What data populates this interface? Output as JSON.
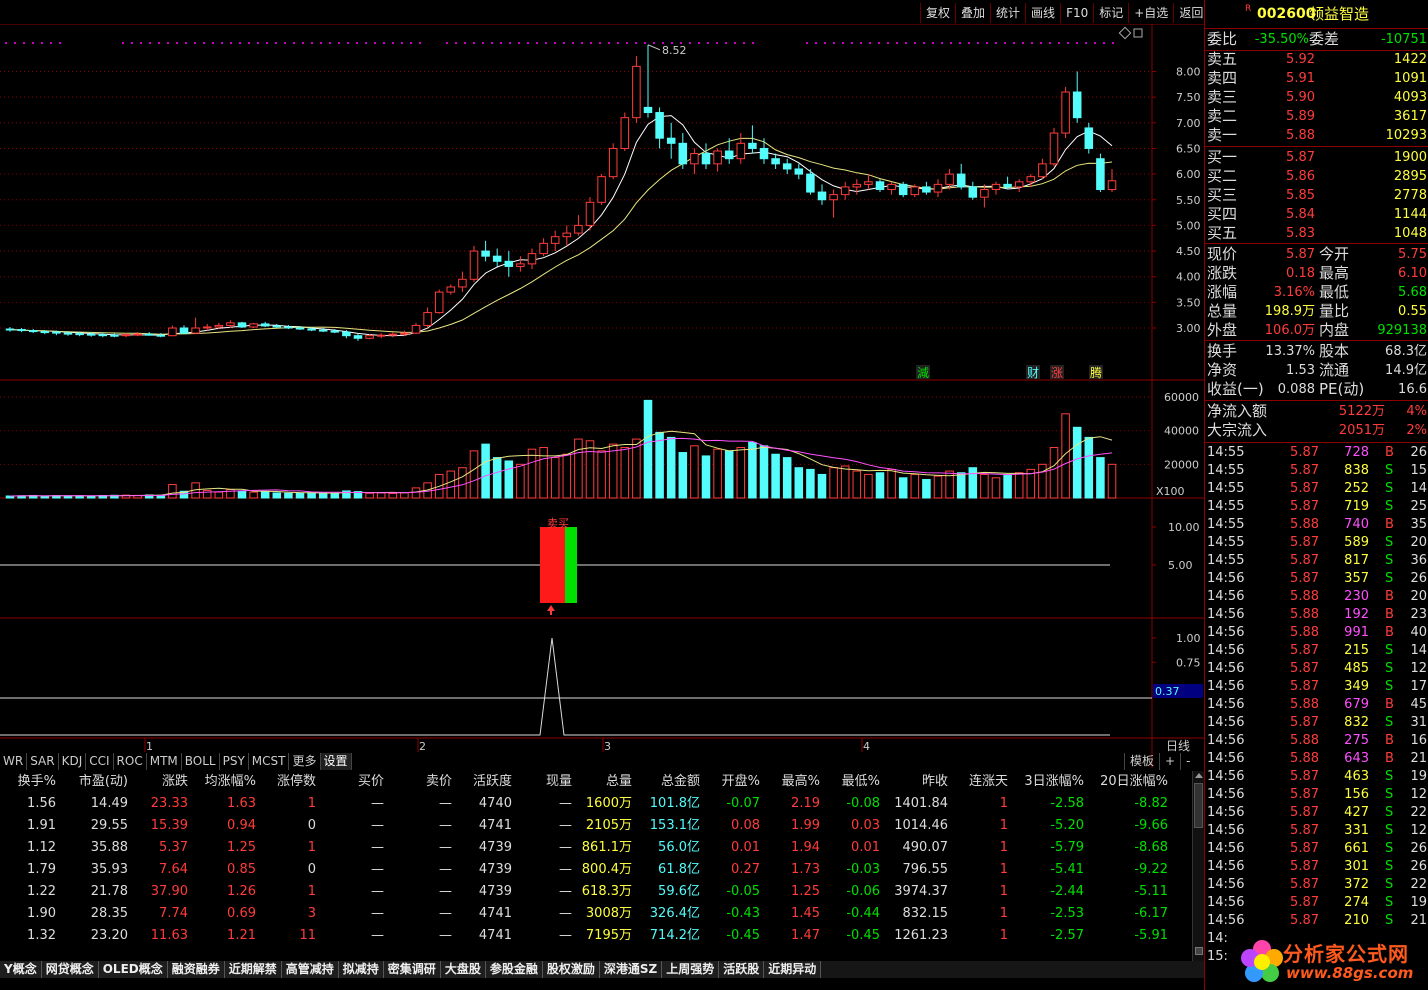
{
  "toolbar": [
    "复权",
    "叠加",
    "统计",
    "画线",
    "F10",
    "标记",
    "+自选",
    "返回"
  ],
  "chart": {
    "price_axis": [
      "8.00",
      "7.50",
      "7.00",
      "6.50",
      "6.00",
      "5.50",
      "5.00",
      "4.50",
      "4.00",
      "3.50",
      "3.00"
    ],
    "high_label": "8.52",
    "volume_axis": [
      "60000",
      "40000",
      "20000"
    ],
    "volume_unit": "X100",
    "ind3_axis": [
      "10.00",
      "5.00"
    ],
    "ind4_axis": [
      "1.00",
      "0.75"
    ],
    "ind4_value": "0.37",
    "month_labels": [
      "1",
      "2",
      "3",
      "4"
    ],
    "period": "日线",
    "event_labels": [
      {
        "text": "減",
        "color": "#00e000"
      },
      {
        "text": "财",
        "color": "#54fcfc"
      },
      {
        "text": "涨",
        "color": "#ff3c3c"
      },
      {
        "text": "腾",
        "color": "#ffff40"
      }
    ],
    "ind3_label": "卖买",
    "candles": [
      [
        2.98,
        3.02,
        2.93,
        2.97
      ],
      [
        2.97,
        3.0,
        2.92,
        2.95
      ],
      [
        2.95,
        2.98,
        2.9,
        2.93
      ],
      [
        2.93,
        2.96,
        2.88,
        2.92
      ],
      [
        2.92,
        2.95,
        2.86,
        2.9
      ],
      [
        2.9,
        2.94,
        2.85,
        2.89
      ],
      [
        2.89,
        2.93,
        2.84,
        2.88
      ],
      [
        2.88,
        2.92,
        2.83,
        2.87
      ],
      [
        2.87,
        2.91,
        2.82,
        2.86
      ],
      [
        2.86,
        2.9,
        2.82,
        2.85
      ],
      [
        2.85,
        2.9,
        2.82,
        2.87
      ],
      [
        2.87,
        2.92,
        2.84,
        2.88
      ],
      [
        2.88,
        2.92,
        2.85,
        2.86
      ],
      [
        2.86,
        2.9,
        2.82,
        2.85
      ],
      [
        2.85,
        3.05,
        2.84,
        3.0
      ],
      [
        3.0,
        3.05,
        2.88,
        2.9
      ],
      [
        2.9,
        3.2,
        2.88,
        3.0
      ],
      [
        3.0,
        3.08,
        2.95,
        3.02
      ],
      [
        3.02,
        3.1,
        2.98,
        3.05
      ],
      [
        3.05,
        3.15,
        3.0,
        3.1
      ],
      [
        3.1,
        3.12,
        3.0,
        3.02
      ],
      [
        3.02,
        3.1,
        3.0,
        3.08
      ],
      [
        3.08,
        3.12,
        3.02,
        3.04
      ],
      [
        3.04,
        3.08,
        3.0,
        3.02
      ],
      [
        3.02,
        3.06,
        2.98,
        3.0
      ],
      [
        3.0,
        3.04,
        2.96,
        2.98
      ],
      [
        2.98,
        3.02,
        2.94,
        2.96
      ],
      [
        2.96,
        3.0,
        2.92,
        2.94
      ],
      [
        2.94,
        2.98,
        2.9,
        2.92
      ],
      [
        2.92,
        2.96,
        2.8,
        2.85
      ],
      [
        2.85,
        2.9,
        2.75,
        2.8
      ],
      [
        2.8,
        2.88,
        2.78,
        2.85
      ],
      [
        2.85,
        2.9,
        2.8,
        2.86
      ],
      [
        2.86,
        2.92,
        2.82,
        2.88
      ],
      [
        2.88,
        2.95,
        2.84,
        2.9
      ],
      [
        2.9,
        3.1,
        2.88,
        3.05
      ],
      [
        3.05,
        3.4,
        3.02,
        3.3
      ],
      [
        3.3,
        3.75,
        3.28,
        3.7
      ],
      [
        3.7,
        3.85,
        3.65,
        3.8
      ],
      [
        3.8,
        4.1,
        3.7,
        3.95
      ],
      [
        3.95,
        4.6,
        3.9,
        4.5
      ],
      [
        4.5,
        4.7,
        4.3,
        4.4
      ],
      [
        4.4,
        4.55,
        4.2,
        4.3
      ],
      [
        4.3,
        4.5,
        4.0,
        4.2
      ],
      [
        4.2,
        4.4,
        4.1,
        4.25
      ],
      [
        4.25,
        4.55,
        4.15,
        4.45
      ],
      [
        4.45,
        4.75,
        4.4,
        4.65
      ],
      [
        4.65,
        4.9,
        4.5,
        4.78
      ],
      [
        4.78,
        5.0,
        4.6,
        4.85
      ],
      [
        4.85,
        5.2,
        4.8,
        5.0
      ],
      [
        5.0,
        5.55,
        4.9,
        5.45
      ],
      [
        5.45,
        6.0,
        5.4,
        5.95
      ],
      [
        5.95,
        6.6,
        5.9,
        6.5
      ],
      [
        6.5,
        7.2,
        6.45,
        7.1
      ],
      [
        7.1,
        8.3,
        7.0,
        8.1
      ],
      [
        7.3,
        8.52,
        7.1,
        7.2
      ],
      [
        7.2,
        7.3,
        6.5,
        6.7
      ],
      [
        6.7,
        7.0,
        6.3,
        6.6
      ],
      [
        6.6,
        6.8,
        6.1,
        6.2
      ],
      [
        6.2,
        6.5,
        6.0,
        6.4
      ],
      [
        6.4,
        6.6,
        6.1,
        6.2
      ],
      [
        6.2,
        6.5,
        6.05,
        6.45
      ],
      [
        6.45,
        6.7,
        6.2,
        6.3
      ],
      [
        6.3,
        6.8,
        6.2,
        6.6
      ],
      [
        6.6,
        6.95,
        6.4,
        6.5
      ],
      [
        6.5,
        6.7,
        6.2,
        6.3
      ],
      [
        6.3,
        6.4,
        6.1,
        6.2
      ],
      [
        6.2,
        6.3,
        6.0,
        6.1
      ],
      [
        6.1,
        6.2,
        5.9,
        6.0
      ],
      [
        6.0,
        6.1,
        5.6,
        5.65
      ],
      [
        5.65,
        5.8,
        5.4,
        5.5
      ],
      [
        5.5,
        5.7,
        5.15,
        5.6
      ],
      [
        5.6,
        5.85,
        5.5,
        5.75
      ],
      [
        5.75,
        5.9,
        5.6,
        5.8
      ],
      [
        5.8,
        6.0,
        5.7,
        5.85
      ],
      [
        5.85,
        5.9,
        5.65,
        5.7
      ],
      [
        5.7,
        5.85,
        5.6,
        5.8
      ],
      [
        5.8,
        5.85,
        5.55,
        5.6
      ],
      [
        5.6,
        5.8,
        5.55,
        5.75
      ],
      [
        5.75,
        5.85,
        5.6,
        5.65
      ],
      [
        5.65,
        5.9,
        5.55,
        5.8
      ],
      [
        5.8,
        6.1,
        5.7,
        6.0
      ],
      [
        6.0,
        6.2,
        5.7,
        5.75
      ],
      [
        5.75,
        5.85,
        5.5,
        5.55
      ],
      [
        5.55,
        5.8,
        5.35,
        5.7
      ],
      [
        5.7,
        5.85,
        5.6,
        5.8
      ],
      [
        5.8,
        5.95,
        5.7,
        5.75
      ],
      [
        5.75,
        5.9,
        5.65,
        5.85
      ],
      [
        5.85,
        6.0,
        5.75,
        5.95
      ],
      [
        5.95,
        6.3,
        5.9,
        6.2
      ],
      [
        6.2,
        6.9,
        6.15,
        6.8
      ],
      [
        6.8,
        7.7,
        6.7,
        7.6
      ],
      [
        7.6,
        8.0,
        7.0,
        7.1
      ],
      [
        6.9,
        7.0,
        6.4,
        6.5
      ],
      [
        6.3,
        6.4,
        5.65,
        5.7
      ],
      [
        5.7,
        6.1,
        5.65,
        5.87
      ]
    ],
    "volumes": [
      1200,
      1300,
      1500,
      1100,
      1400,
      1250,
      1350,
      1200,
      1500,
      1600,
      1700,
      1550,
      1800,
      1600,
      8000,
      4000,
      9000,
      4500,
      3500,
      5000,
      4000,
      3500,
      3800,
      3000,
      2800,
      3000,
      3200,
      2900,
      2600,
      4200,
      3800,
      2800,
      3000,
      2700,
      3200,
      6000,
      9000,
      14000,
      16000,
      18000,
      28000,
      32000,
      24000,
      22000,
      20000,
      29000,
      30000,
      24000,
      26000,
      35000,
      34000,
      28000,
      32000,
      30000,
      35000,
      58000,
      39000,
      36000,
      27000,
      31000,
      25000,
      29000,
      28000,
      30000,
      33000,
      31000,
      26000,
      24000,
      18000,
      17000,
      14000,
      18000,
      19000,
      16000,
      14000,
      15000,
      17000,
      12000,
      14000,
      11000,
      13000,
      16000,
      15000,
      18000,
      14000,
      12000,
      14000,
      15000,
      17000,
      20000,
      30000,
      50000,
      42000,
      36000,
      24000,
      20000
    ]
  },
  "indicators": [
    "WR",
    "SAR",
    "KDJ",
    "CCI",
    "ROC",
    "MTM",
    "BOLL",
    "PSY",
    "MCST",
    "更多",
    "设置"
  ],
  "template_tabs": [
    "模板",
    "+",
    "-"
  ],
  "table": {
    "columns": [
      "换手%",
      "市盈(动)",
      "涨跌",
      "均涨幅%",
      "涨停数",
      "买价",
      "卖价",
      "活跃度",
      "现量",
      "总量",
      "总金额",
      "开盘%",
      "最高%",
      "最低%",
      "昨收",
      "连涨天",
      "3日涨幅%",
      "20日涨幅%"
    ],
    "rows": [
      [
        "1.56",
        "14.49",
        "23.33",
        "1.63",
        "1",
        "—",
        "—",
        "4740",
        "—",
        "1600万",
        "101.8亿",
        "-0.07",
        "2.19",
        "-0.08",
        "1401.84",
        "1",
        "-2.58",
        "-8.82"
      ],
      [
        "1.91",
        "29.55",
        "15.39",
        "0.94",
        "0",
        "—",
        "—",
        "4741",
        "—",
        "2105万",
        "153.1亿",
        "0.08",
        "1.99",
        "0.03",
        "1014.46",
        "1",
        "-5.20",
        "-9.66"
      ],
      [
        "1.12",
        "35.88",
        "5.37",
        "1.25",
        "1",
        "—",
        "—",
        "4739",
        "—",
        "861.1万",
        "56.0亿",
        "0.01",
        "1.94",
        "0.01",
        "490.07",
        "1",
        "-5.79",
        "-8.68"
      ],
      [
        "1.79",
        "35.93",
        "7.64",
        "0.85",
        "0",
        "—",
        "—",
        "4739",
        "—",
        "800.4万",
        "61.8亿",
        "0.27",
        "1.73",
        "-0.03",
        "796.55",
        "1",
        "-5.41",
        "-9.22"
      ],
      [
        "1.22",
        "21.78",
        "37.90",
        "1.26",
        "1",
        "—",
        "—",
        "4739",
        "—",
        "618.3万",
        "59.6亿",
        "-0.05",
        "1.25",
        "-0.06",
        "3974.37",
        "1",
        "-2.44",
        "-5.11"
      ],
      [
        "1.90",
        "28.35",
        "7.74",
        "0.69",
        "3",
        "—",
        "—",
        "4741",
        "—",
        "3008万",
        "326.4亿",
        "-0.43",
        "1.45",
        "-0.44",
        "832.15",
        "1",
        "-2.53",
        "-6.17"
      ],
      [
        "1.32",
        "23.20",
        "11.63",
        "1.21",
        "11",
        "—",
        "—",
        "4741",
        "—",
        "7195万",
        "714.2亿",
        "-0.45",
        "1.47",
        "-0.45",
        "1261.23",
        "1",
        "-2.57",
        "-5.91"
      ]
    ]
  },
  "sector_tabs": [
    "Y概念",
    "网贷概念",
    "OLED概念",
    "融资融券",
    "近期解禁",
    "高管减持",
    "拟减持",
    "密集调研",
    "大盘股",
    "参股金融",
    "股权激励",
    "深港通SZ",
    "上周强势",
    "活跃股",
    "近期异动"
  ],
  "quote": {
    "r_mark": "R",
    "code": "002600",
    "name": "领益智造",
    "weibi_label": "委比",
    "weibi": "-35.50%",
    "weicha_label": "委差",
    "weicha": "-10751",
    "asks": [
      [
        "卖五",
        "5.92",
        "1422"
      ],
      [
        "卖四",
        "5.91",
        "1091"
      ],
      [
        "卖三",
        "5.90",
        "4093"
      ],
      [
        "卖二",
        "5.89",
        "3617"
      ],
      [
        "卖一",
        "5.88",
        "10293"
      ]
    ],
    "bids": [
      [
        "买一",
        "5.87",
        "1900"
      ],
      [
        "买二",
        "5.86",
        "2895"
      ],
      [
        "买三",
        "5.85",
        "2778"
      ],
      [
        "买四",
        "5.84",
        "1144"
      ],
      [
        "买五",
        "5.83",
        "1048"
      ]
    ],
    "stats": [
      [
        "现价",
        "5.87",
        "今开",
        "5.75"
      ],
      [
        "涨跌",
        "0.18",
        "最高",
        "6.10"
      ],
      [
        "涨幅",
        "3.16%",
        "最低",
        "5.68"
      ],
      [
        "总量",
        "198.9万",
        "量比",
        "0.55"
      ],
      [
        "外盘",
        "106.0万",
        "内盘",
        "929138"
      ]
    ],
    "stats2": [
      [
        "换手",
        "13.37%",
        "股本",
        "68.3亿"
      ],
      [
        "净资",
        "1.53",
        "流通",
        "14.9亿"
      ],
      [
        "收益(一)",
        "0.088",
        "PE(动)",
        "16.6"
      ]
    ],
    "flow": [
      [
        "净流入额",
        "5122万",
        "4%"
      ],
      [
        "大宗流入",
        "2051万",
        "2%"
      ]
    ]
  },
  "ticks": [
    [
      "14:55",
      "5.87",
      "728",
      "B",
      "26"
    ],
    [
      "14:55",
      "5.87",
      "838",
      "S",
      "15"
    ],
    [
      "14:55",
      "5.87",
      "252",
      "S",
      "14"
    ],
    [
      "14:55",
      "5.87",
      "719",
      "S",
      "25"
    ],
    [
      "14:55",
      "5.88",
      "740",
      "B",
      "35"
    ],
    [
      "14:55",
      "5.87",
      "589",
      "S",
      "20"
    ],
    [
      "14:55",
      "5.87",
      "817",
      "S",
      "36"
    ],
    [
      "14:56",
      "5.87",
      "357",
      "S",
      "26"
    ],
    [
      "14:56",
      "5.88",
      "230",
      "B",
      "20"
    ],
    [
      "14:56",
      "5.88",
      "192",
      "B",
      "23"
    ],
    [
      "14:56",
      "5.88",
      "991",
      "B",
      "40"
    ],
    [
      "14:56",
      "5.87",
      "215",
      "S",
      "14"
    ],
    [
      "14:56",
      "5.87",
      "485",
      "S",
      "12"
    ],
    [
      "14:56",
      "5.87",
      "349",
      "S",
      "17"
    ],
    [
      "14:56",
      "5.88",
      "679",
      "B",
      "45"
    ],
    [
      "14:56",
      "5.87",
      "832",
      "S",
      "31"
    ],
    [
      "14:56",
      "5.88",
      "275",
      "B",
      "16"
    ],
    [
      "14:56",
      "5.88",
      "643",
      "B",
      "21"
    ],
    [
      "14:56",
      "5.87",
      "463",
      "S",
      "19"
    ],
    [
      "14:56",
      "5.87",
      "156",
      "S",
      "12"
    ],
    [
      "14:56",
      "5.87",
      "427",
      "S",
      "22"
    ],
    [
      "14:56",
      "5.87",
      "331",
      "S",
      "12"
    ],
    [
      "14:56",
      "5.87",
      "661",
      "S",
      "26"
    ],
    [
      "14:56",
      "5.87",
      "301",
      "S",
      "26"
    ],
    [
      "14:56",
      "5.87",
      "372",
      "S",
      "22"
    ],
    [
      "14:56",
      "5.87",
      "274",
      "S",
      "19"
    ],
    [
      "14:56",
      "5.87",
      "210",
      "S",
      "21"
    ],
    [
      "14:",
      "",
      "",
      "",
      ""
    ],
    [
      "15:",
      "",
      "",
      "",
      ""
    ]
  ],
  "watermark": {
    "name": "分析家公式网",
    "url": "www.88gs.com"
  }
}
